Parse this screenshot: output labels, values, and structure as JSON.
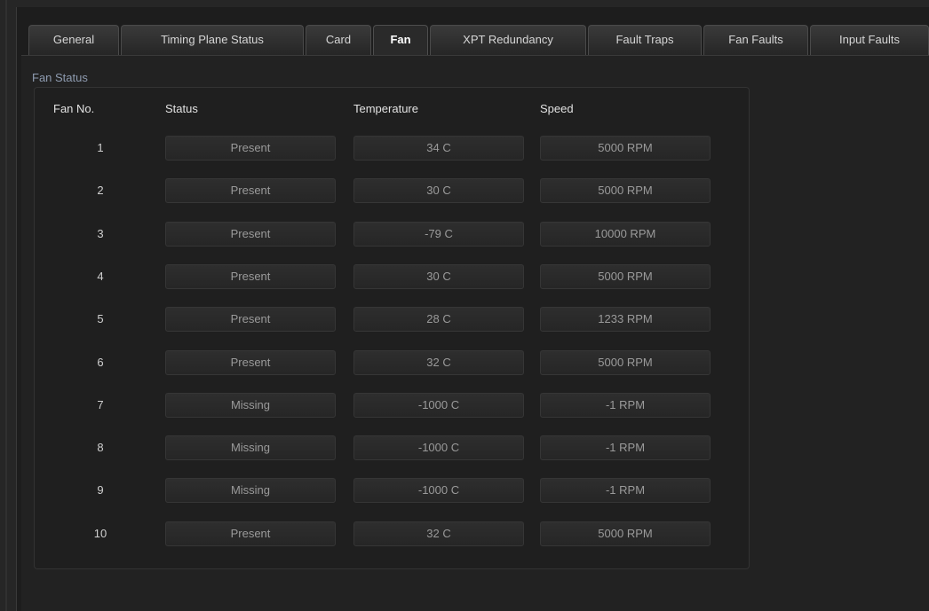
{
  "tabs": [
    {
      "label": "General",
      "active": false
    },
    {
      "label": "Timing Plane Status",
      "active": false
    },
    {
      "label": "Card",
      "active": false
    },
    {
      "label": "Fan",
      "active": true
    },
    {
      "label": "XPT Redundancy",
      "active": false
    },
    {
      "label": "Fault Traps",
      "active": false
    },
    {
      "label": "Fan Faults",
      "active": false
    },
    {
      "label": "Input Faults",
      "active": false
    }
  ],
  "section_title": "Fan Status",
  "columns": {
    "fan_no": "Fan No.",
    "status": "Status",
    "temperature": "Temperature",
    "speed": "Speed"
  },
  "fans": [
    {
      "no": "1",
      "status": "Present",
      "temperature": "34 C",
      "speed": "5000 RPM"
    },
    {
      "no": "2",
      "status": "Present",
      "temperature": "30 C",
      "speed": "5000 RPM"
    },
    {
      "no": "3",
      "status": "Present",
      "temperature": "-79 C",
      "speed": "10000 RPM"
    },
    {
      "no": "4",
      "status": "Present",
      "temperature": "30 C",
      "speed": "5000 RPM"
    },
    {
      "no": "5",
      "status": "Present",
      "temperature": "28 C",
      "speed": "1233 RPM"
    },
    {
      "no": "6",
      "status": "Present",
      "temperature": "32 C",
      "speed": "5000 RPM"
    },
    {
      "no": "7",
      "status": "Missing",
      "temperature": "-1000 C",
      "speed": "-1 RPM"
    },
    {
      "no": "8",
      "status": "Missing",
      "temperature": "-1000 C",
      "speed": "-1 RPM"
    },
    {
      "no": "9",
      "status": "Missing",
      "temperature": "-1000 C",
      "speed": "-1 RPM"
    },
    {
      "no": "10",
      "status": "Present",
      "temperature": "32 C",
      "speed": "5000 RPM"
    }
  ]
}
